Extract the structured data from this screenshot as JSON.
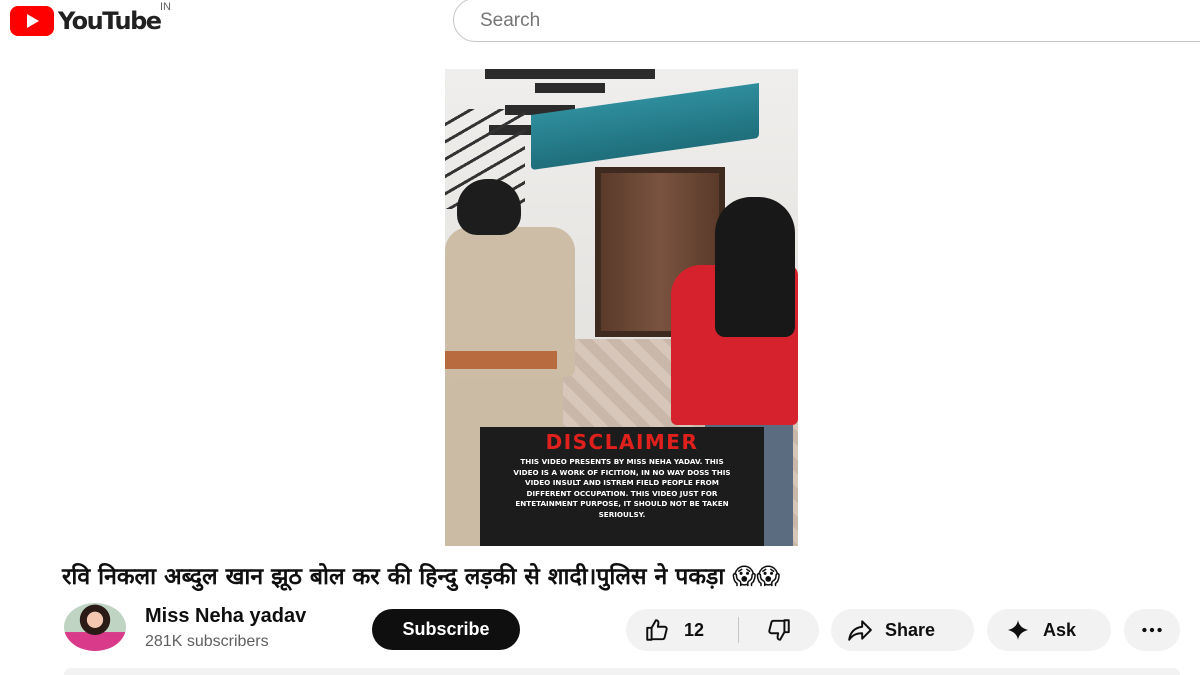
{
  "header": {
    "logo_text": "YouTube",
    "country_code": "IN",
    "search_placeholder": "Search"
  },
  "video": {
    "disclaimer_title": "DISCLAIMER",
    "disclaimer_text": "THIS VIDEO PRESENTS BY MISS NEHA YADAV. THIS VIDEO IS A WORK OF FICITION, IN NO WAY DOSS THIS VIDEO INSULT AND ISTREM FIELD PEOPLE FROM DIFFERENT OCCUPATION. THIS VIDEO JUST FOR ENTETAINMENT PURPOSE, IT SHOULD NOT BE TAKEN SERIOULSY.",
    "title": "रवि निकला अब्दुल खान झूठ बोल कर की हिन्दु लड़की से शादी।पुलिस ने पकड़ा 😱😱"
  },
  "channel": {
    "name": "Miss Neha yadav",
    "subscribers": "281K subscribers",
    "subscribe_label": "Subscribe"
  },
  "actions": {
    "like_count": "12",
    "share_label": "Share",
    "ask_label": "Ask"
  },
  "icons": {
    "like": "thumbs-up-icon",
    "dislike": "thumbs-down-icon",
    "share": "share-arrow-icon",
    "ask": "sparkle-icon",
    "more": "more-horizontal-icon"
  },
  "colors": {
    "brand_red": "#ff0000",
    "subscribe_bg": "#0f0f0f",
    "pill_bg": "#f2f2f2",
    "disclaimer_title": "#e0201c"
  }
}
